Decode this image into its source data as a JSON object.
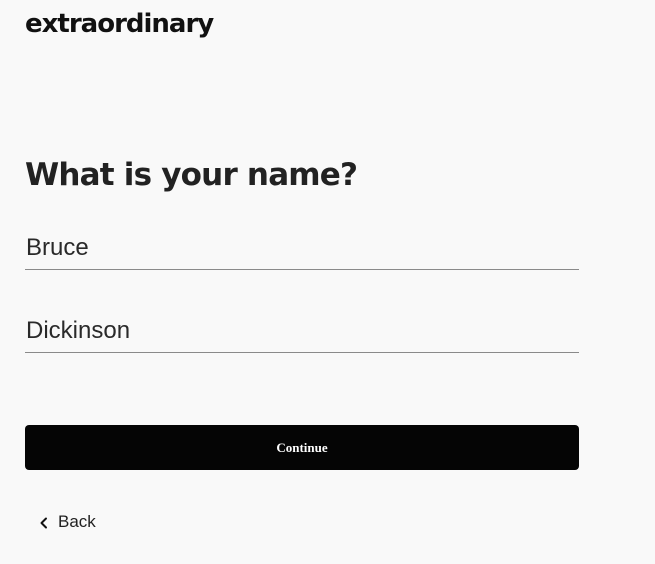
{
  "brand": {
    "logo_text": "extraordinary"
  },
  "form": {
    "heading": "What is your name?",
    "first_name_value": "Bruce",
    "last_name_value": "Dickinson",
    "continue_label": "Continue",
    "back_label": "Back",
    "back_icon": "chevron-left-icon"
  }
}
